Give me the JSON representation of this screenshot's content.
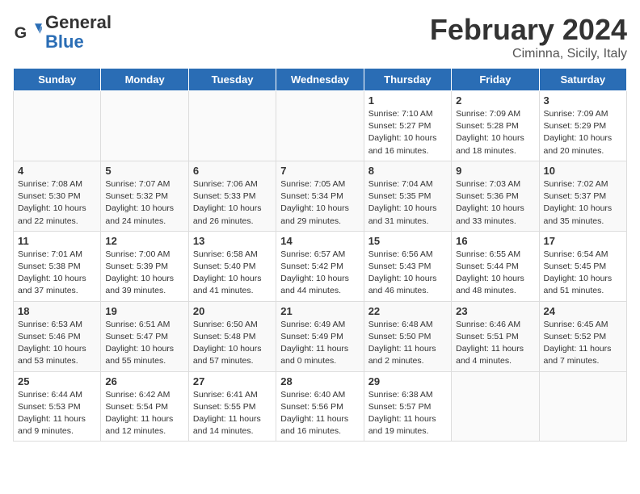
{
  "logo": {
    "general": "General",
    "blue": "Blue"
  },
  "header": {
    "title": "February 2024",
    "subtitle": "Ciminna, Sicily, Italy"
  },
  "weekdays": [
    "Sunday",
    "Monday",
    "Tuesday",
    "Wednesday",
    "Thursday",
    "Friday",
    "Saturday"
  ],
  "weeks": [
    [
      {
        "day": "",
        "info": ""
      },
      {
        "day": "",
        "info": ""
      },
      {
        "day": "",
        "info": ""
      },
      {
        "day": "",
        "info": ""
      },
      {
        "day": "1",
        "info": "Sunrise: 7:10 AM\nSunset: 5:27 PM\nDaylight: 10 hours\nand 16 minutes."
      },
      {
        "day": "2",
        "info": "Sunrise: 7:09 AM\nSunset: 5:28 PM\nDaylight: 10 hours\nand 18 minutes."
      },
      {
        "day": "3",
        "info": "Sunrise: 7:09 AM\nSunset: 5:29 PM\nDaylight: 10 hours\nand 20 minutes."
      }
    ],
    [
      {
        "day": "4",
        "info": "Sunrise: 7:08 AM\nSunset: 5:30 PM\nDaylight: 10 hours\nand 22 minutes."
      },
      {
        "day": "5",
        "info": "Sunrise: 7:07 AM\nSunset: 5:32 PM\nDaylight: 10 hours\nand 24 minutes."
      },
      {
        "day": "6",
        "info": "Sunrise: 7:06 AM\nSunset: 5:33 PM\nDaylight: 10 hours\nand 26 minutes."
      },
      {
        "day": "7",
        "info": "Sunrise: 7:05 AM\nSunset: 5:34 PM\nDaylight: 10 hours\nand 29 minutes."
      },
      {
        "day": "8",
        "info": "Sunrise: 7:04 AM\nSunset: 5:35 PM\nDaylight: 10 hours\nand 31 minutes."
      },
      {
        "day": "9",
        "info": "Sunrise: 7:03 AM\nSunset: 5:36 PM\nDaylight: 10 hours\nand 33 minutes."
      },
      {
        "day": "10",
        "info": "Sunrise: 7:02 AM\nSunset: 5:37 PM\nDaylight: 10 hours\nand 35 minutes."
      }
    ],
    [
      {
        "day": "11",
        "info": "Sunrise: 7:01 AM\nSunset: 5:38 PM\nDaylight: 10 hours\nand 37 minutes."
      },
      {
        "day": "12",
        "info": "Sunrise: 7:00 AM\nSunset: 5:39 PM\nDaylight: 10 hours\nand 39 minutes."
      },
      {
        "day": "13",
        "info": "Sunrise: 6:58 AM\nSunset: 5:40 PM\nDaylight: 10 hours\nand 41 minutes."
      },
      {
        "day": "14",
        "info": "Sunrise: 6:57 AM\nSunset: 5:42 PM\nDaylight: 10 hours\nand 44 minutes."
      },
      {
        "day": "15",
        "info": "Sunrise: 6:56 AM\nSunset: 5:43 PM\nDaylight: 10 hours\nand 46 minutes."
      },
      {
        "day": "16",
        "info": "Sunrise: 6:55 AM\nSunset: 5:44 PM\nDaylight: 10 hours\nand 48 minutes."
      },
      {
        "day": "17",
        "info": "Sunrise: 6:54 AM\nSunset: 5:45 PM\nDaylight: 10 hours\nand 51 minutes."
      }
    ],
    [
      {
        "day": "18",
        "info": "Sunrise: 6:53 AM\nSunset: 5:46 PM\nDaylight: 10 hours\nand 53 minutes."
      },
      {
        "day": "19",
        "info": "Sunrise: 6:51 AM\nSunset: 5:47 PM\nDaylight: 10 hours\nand 55 minutes."
      },
      {
        "day": "20",
        "info": "Sunrise: 6:50 AM\nSunset: 5:48 PM\nDaylight: 10 hours\nand 57 minutes."
      },
      {
        "day": "21",
        "info": "Sunrise: 6:49 AM\nSunset: 5:49 PM\nDaylight: 11 hours\nand 0 minutes."
      },
      {
        "day": "22",
        "info": "Sunrise: 6:48 AM\nSunset: 5:50 PM\nDaylight: 11 hours\nand 2 minutes."
      },
      {
        "day": "23",
        "info": "Sunrise: 6:46 AM\nSunset: 5:51 PM\nDaylight: 11 hours\nand 4 minutes."
      },
      {
        "day": "24",
        "info": "Sunrise: 6:45 AM\nSunset: 5:52 PM\nDaylight: 11 hours\nand 7 minutes."
      }
    ],
    [
      {
        "day": "25",
        "info": "Sunrise: 6:44 AM\nSunset: 5:53 PM\nDaylight: 11 hours\nand 9 minutes."
      },
      {
        "day": "26",
        "info": "Sunrise: 6:42 AM\nSunset: 5:54 PM\nDaylight: 11 hours\nand 12 minutes."
      },
      {
        "day": "27",
        "info": "Sunrise: 6:41 AM\nSunset: 5:55 PM\nDaylight: 11 hours\nand 14 minutes."
      },
      {
        "day": "28",
        "info": "Sunrise: 6:40 AM\nSunset: 5:56 PM\nDaylight: 11 hours\nand 16 minutes."
      },
      {
        "day": "29",
        "info": "Sunrise: 6:38 AM\nSunset: 5:57 PM\nDaylight: 11 hours\nand 19 minutes."
      },
      {
        "day": "",
        "info": ""
      },
      {
        "day": "",
        "info": ""
      }
    ]
  ]
}
